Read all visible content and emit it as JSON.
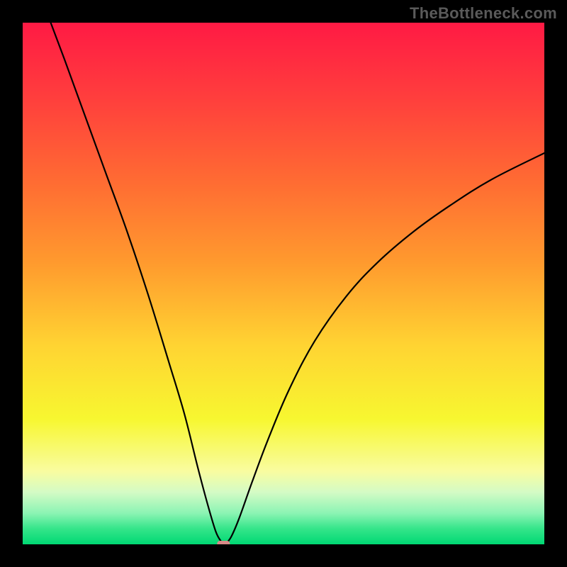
{
  "watermark": "TheBottleneck.com",
  "colors": {
    "frame": "#000000",
    "curve": "#000000",
    "marker": "#d98a88",
    "gradient_stops": [
      {
        "offset": 0.0,
        "color": "#ff1a44"
      },
      {
        "offset": 0.14,
        "color": "#ff3d3d"
      },
      {
        "offset": 0.3,
        "color": "#ff6a33"
      },
      {
        "offset": 0.46,
        "color": "#ff9a2e"
      },
      {
        "offset": 0.62,
        "color": "#ffd432"
      },
      {
        "offset": 0.76,
        "color": "#f7f730"
      },
      {
        "offset": 0.86,
        "color": "#f9fca0"
      },
      {
        "offset": 0.9,
        "color": "#d4fbc5"
      },
      {
        "offset": 0.94,
        "color": "#8cf4b4"
      },
      {
        "offset": 0.97,
        "color": "#35e58a"
      },
      {
        "offset": 1.0,
        "color": "#00d873"
      }
    ]
  },
  "chart_data": {
    "type": "line",
    "title": "",
    "xlabel": "",
    "ylabel": "",
    "xlim": [
      0,
      100
    ],
    "ylim": [
      0,
      100
    ],
    "grid": false,
    "legend": false,
    "minimum_marker": {
      "x": 38.5,
      "y": 0
    },
    "series": [
      {
        "name": "bottleneck-curve",
        "points": [
          {
            "x": 5.0,
            "y": 101.0
          },
          {
            "x": 8.0,
            "y": 93.0
          },
          {
            "x": 12.0,
            "y": 82.0
          },
          {
            "x": 16.0,
            "y": 71.0
          },
          {
            "x": 20.0,
            "y": 60.0
          },
          {
            "x": 24.0,
            "y": 48.0
          },
          {
            "x": 28.0,
            "y": 35.0
          },
          {
            "x": 31.0,
            "y": 25.0
          },
          {
            "x": 33.5,
            "y": 15.0
          },
          {
            "x": 35.5,
            "y": 7.5
          },
          {
            "x": 37.0,
            "y": 2.5
          },
          {
            "x": 38.0,
            "y": 0.6
          },
          {
            "x": 38.5,
            "y": 0.0
          },
          {
            "x": 39.0,
            "y": 0.2
          },
          {
            "x": 40.0,
            "y": 1.5
          },
          {
            "x": 41.5,
            "y": 5.0
          },
          {
            "x": 44.0,
            "y": 12.0
          },
          {
            "x": 47.0,
            "y": 20.0
          },
          {
            "x": 51.0,
            "y": 29.5
          },
          {
            "x": 56.0,
            "y": 39.0
          },
          {
            "x": 62.0,
            "y": 47.5
          },
          {
            "x": 68.0,
            "y": 54.0
          },
          {
            "x": 75.0,
            "y": 60.0
          },
          {
            "x": 82.0,
            "y": 65.0
          },
          {
            "x": 90.0,
            "y": 70.0
          },
          {
            "x": 100.0,
            "y": 75.0
          }
        ]
      }
    ]
  }
}
